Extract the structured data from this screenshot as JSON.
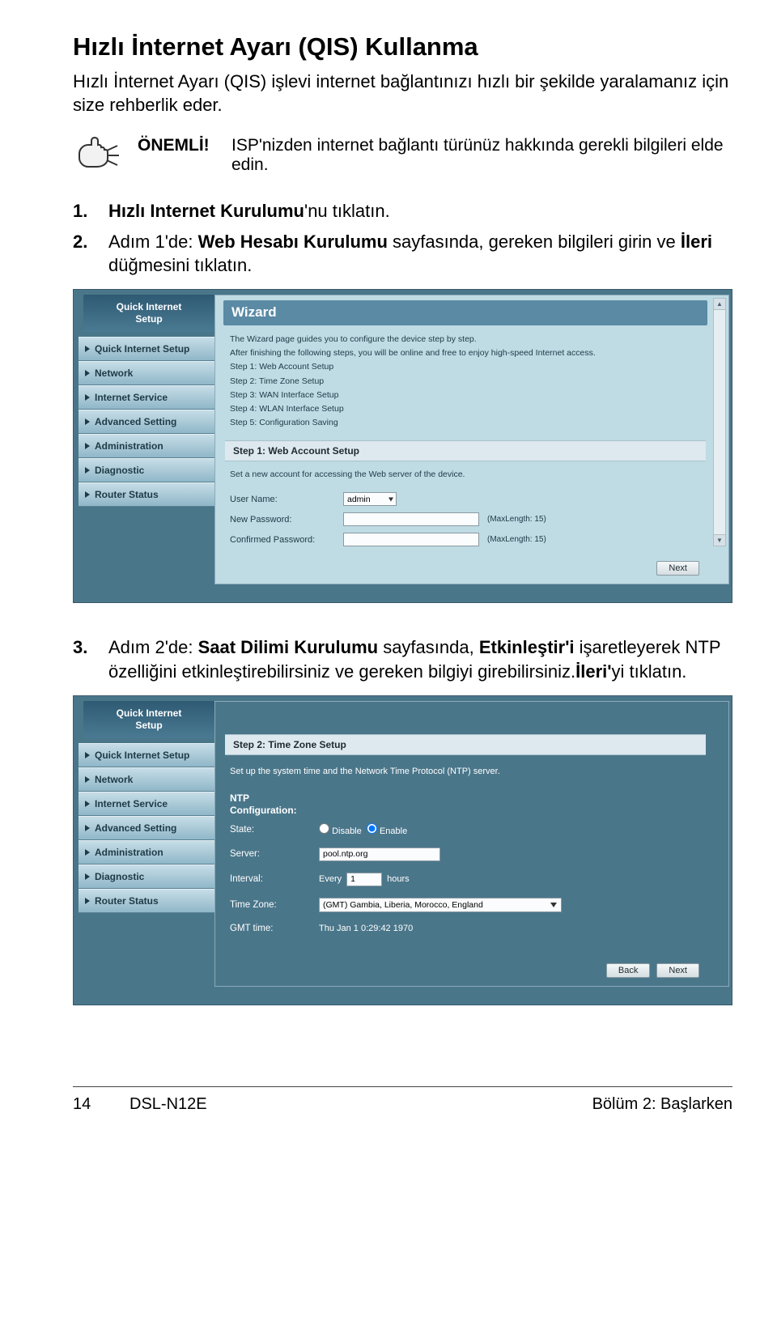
{
  "title": "Hızlı İnternet Ayarı (QIS) Kullanma",
  "intro": "Hızlı İnternet Ayarı (QIS) işlevi internet bağlantınızı hızlı bir şekilde yaralamanız için size rehberlik eder.",
  "note": {
    "label": "ÖNEMLİ!",
    "text": "ISP'nizden internet bağlantı türünüz hakkında gerekli bilgileri elde edin."
  },
  "steps": {
    "s1": {
      "num": "1.",
      "text_a": "Hızlı Internet Kurulumu",
      "text_b": "'nu tıklatın."
    },
    "s2": {
      "num": "2.",
      "text_a": "Adım 1'de: ",
      "bold": "Web Hesabı Kurulumu",
      "text_b": " sayfasında, gereken bilgileri girin ve ",
      "bold2": "İleri",
      "text_c": " düğmesini tıklatın."
    },
    "s3": {
      "num": "3.",
      "text_a": "Adım 2'de: ",
      "bold": "Saat Dilimi Kurulumu",
      "text_b": " sayfasında, ",
      "bold2": "Etkinleştir'i",
      "text_c": " işaretleyerek NTP özelliğini etkinleştirebilirsiniz ve gereken bilgiyi girebilirsiniz.",
      "bold3": "İleri'",
      "text_d": "yi tıklatın."
    }
  },
  "sidebar": {
    "qis_line1": "Quick Internet",
    "qis_line2": "Setup",
    "items": [
      "Quick Internet Setup",
      "Network",
      "Internet Service",
      "Advanced Setting",
      "Administration",
      "Diagnostic",
      "Router Status"
    ]
  },
  "panel1": {
    "wizard_title": "Wizard",
    "wizard_lines": [
      "The Wizard page guides you to configure the device step by step.",
      "After finishing the following steps, you will be online and free to enjoy high-speed Internet access.",
      "Step 1: Web Account Setup",
      "Step 2: Time Zone Setup",
      "Step 3: WAN Interface Setup",
      "Step 4: WLAN Interface Setup",
      "Step 5: Configuration Saving"
    ],
    "step_label": "Step 1: Web Account Setup",
    "step_desc": "Set a new account for accessing the Web server of the device.",
    "user_name_label": "User Name:",
    "user_name_value": "admin",
    "new_pw_label": "New Password:",
    "conf_pw_label": "Confirmed Password:",
    "hint": "(MaxLength: 15)",
    "next": "Next"
  },
  "panel2": {
    "step_label": "Step 2: Time Zone Setup",
    "step_desc": "Set up the system time and the Network Time Protocol (NTP) server.",
    "ntp_conf_l1": "NTP",
    "ntp_conf_l2": "Configuration:",
    "state_label": "State:",
    "disable": "Disable",
    "enable": "Enable",
    "server_label": "Server:",
    "server_value": "pool.ntp.org",
    "interval_label": "Interval:",
    "interval_prefix": "Every",
    "interval_value": "1",
    "interval_suffix": "hours",
    "tz_label": "Time Zone:",
    "tz_value": "(GMT) Gambia, Liberia, Morocco, England",
    "gmt_label": "GMT time:",
    "gmt_value": "Thu Jan 1 0:29:42 1970",
    "back": "Back",
    "next": "Next"
  },
  "footer": {
    "page": "14",
    "model": "DSL-N12E",
    "chapter": "Bölüm 2: Başlarken"
  }
}
